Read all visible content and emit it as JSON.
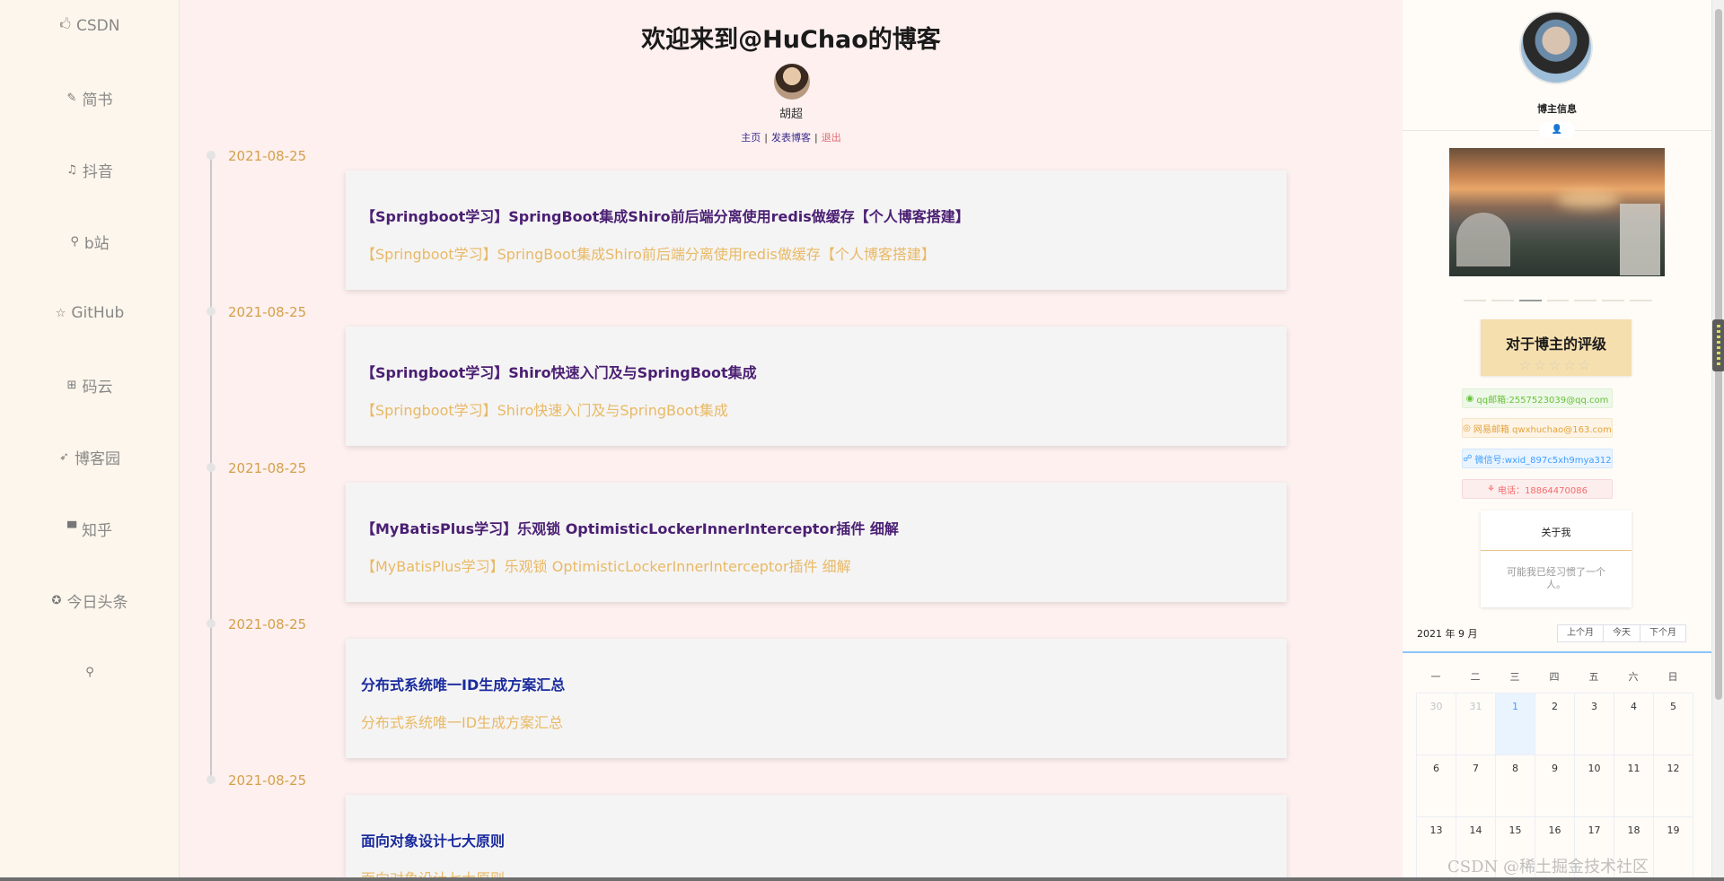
{
  "sidebar": {
    "items": [
      {
        "icon": "🖒",
        "label": "CSDN"
      },
      {
        "icon": "✎",
        "label": "简书"
      },
      {
        "icon": "♫",
        "label": "抖音"
      },
      {
        "icon": "⚲",
        "label": "b站"
      },
      {
        "icon": "☆",
        "label": "GitHub"
      },
      {
        "icon": "⊞",
        "label": "码云"
      },
      {
        "icon": "➶",
        "label": "博客园"
      },
      {
        "icon": "▀",
        "label": "知乎"
      },
      {
        "icon": "✪",
        "label": "今日头条"
      },
      {
        "icon": "⚲",
        "label": ""
      }
    ]
  },
  "header": {
    "title": "欢迎来到@HuChao的博客",
    "author_name": "胡超",
    "nav": {
      "home": "主页",
      "post": "发表博客",
      "logout": "退出"
    }
  },
  "posts": [
    {
      "date": "2021-08-25",
      "title": "【Springboot学习】SpringBoot集成Shiro前后端分离使用redis做缓存【个人博客搭建】",
      "desc": "【Springboot学习】SpringBoot集成Shiro前后端分离使用redis做缓存【个人博客搭建】"
    },
    {
      "date": "2021-08-25",
      "title": "【Springboot学习】Shiro快速入门及与SpringBoot集成",
      "desc": "【Springboot学习】Shiro快速入门及与SpringBoot集成"
    },
    {
      "date": "2021-08-25",
      "title": "【MyBatisPlus学习】乐观锁 OptimisticLockerInnerInterceptor插件 细解",
      "desc": "【MyBatisPlus学习】乐观锁 OptimisticLockerInnerInterceptor插件 细解"
    },
    {
      "date": "2021-08-25",
      "title": "分布式系统唯一ID生成方案汇总",
      "desc": "分布式系统唯一ID生成方案汇总"
    },
    {
      "date": "2021-08-25",
      "title": "面向对象设计七大原则",
      "desc": "面向对象设计七大原则"
    }
  ],
  "right": {
    "blogger_info_label": "博主信息",
    "rating_title": "对于博主的评级",
    "rating_stars": "☆☆☆☆☆",
    "rating_value": 0,
    "contacts": {
      "qq": "qq邮箱:2557523039@qq.com",
      "mail": "网易邮箱 qwxhuchao@163.com",
      "wx": "微信号:wxid_897c5xh9mya312",
      "tel": "电话：18864470086"
    },
    "about_title": "关于我",
    "about_text": "可能我已经习惯了一个人。"
  },
  "calendar": {
    "header": "2021 年 9 月",
    "buttons": {
      "prev": "上个月",
      "today": "今天",
      "next": "下个月"
    },
    "weekdays": [
      "一",
      "二",
      "三",
      "四",
      "五",
      "六",
      "日"
    ],
    "days": [
      {
        "d": "30",
        "other": true
      },
      {
        "d": "31",
        "other": true
      },
      {
        "d": "1",
        "today": true
      },
      {
        "d": "2"
      },
      {
        "d": "3"
      },
      {
        "d": "4"
      },
      {
        "d": "5"
      },
      {
        "d": "6"
      },
      {
        "d": "7"
      },
      {
        "d": "8"
      },
      {
        "d": "9"
      },
      {
        "d": "10"
      },
      {
        "d": "11"
      },
      {
        "d": "12"
      },
      {
        "d": "13"
      },
      {
        "d": "14"
      },
      {
        "d": "15"
      },
      {
        "d": "16"
      },
      {
        "d": "17"
      },
      {
        "d": "18"
      },
      {
        "d": "19"
      }
    ]
  },
  "watermark": "CSDN @稀土掘金技术社区"
}
